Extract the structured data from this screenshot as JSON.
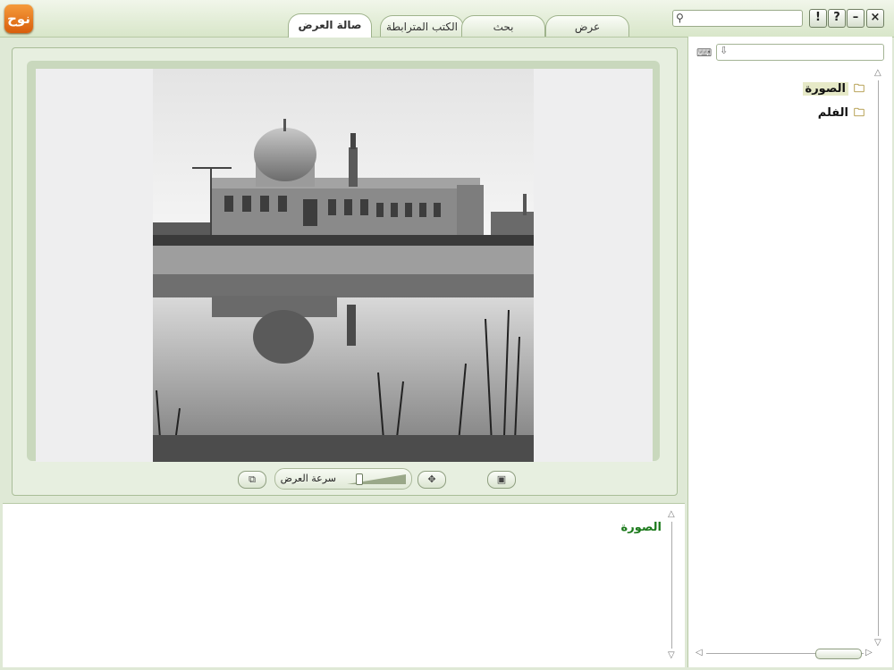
{
  "app": {
    "logo_text": "نوح"
  },
  "tabs": [
    {
      "label": "صالة العرض",
      "active": true
    },
    {
      "label": "الكتب المترابطة",
      "active": false
    },
    {
      "label": "بحث",
      "active": false
    },
    {
      "label": "عرض",
      "active": false
    }
  ],
  "search": {
    "placeholder": "",
    "icon": "magnifier"
  },
  "window_buttons": {
    "info": "!",
    "help": "?",
    "minimize": "–",
    "close": "×"
  },
  "viewer": {
    "speed_label": "سرعة العرض",
    "speed_level": 0.2
  },
  "description": {
    "title": "الصورة"
  },
  "sidebar": {
    "tree": [
      {
        "label": "الصورة",
        "selected": true,
        "icon": "folder"
      },
      {
        "label": "الفلم",
        "selected": false,
        "icon": "folder"
      }
    ]
  },
  "colors": {
    "accent_green": "#1c7a1c",
    "frame": "#c9d8bd",
    "logo_orange": "#e8761c"
  }
}
